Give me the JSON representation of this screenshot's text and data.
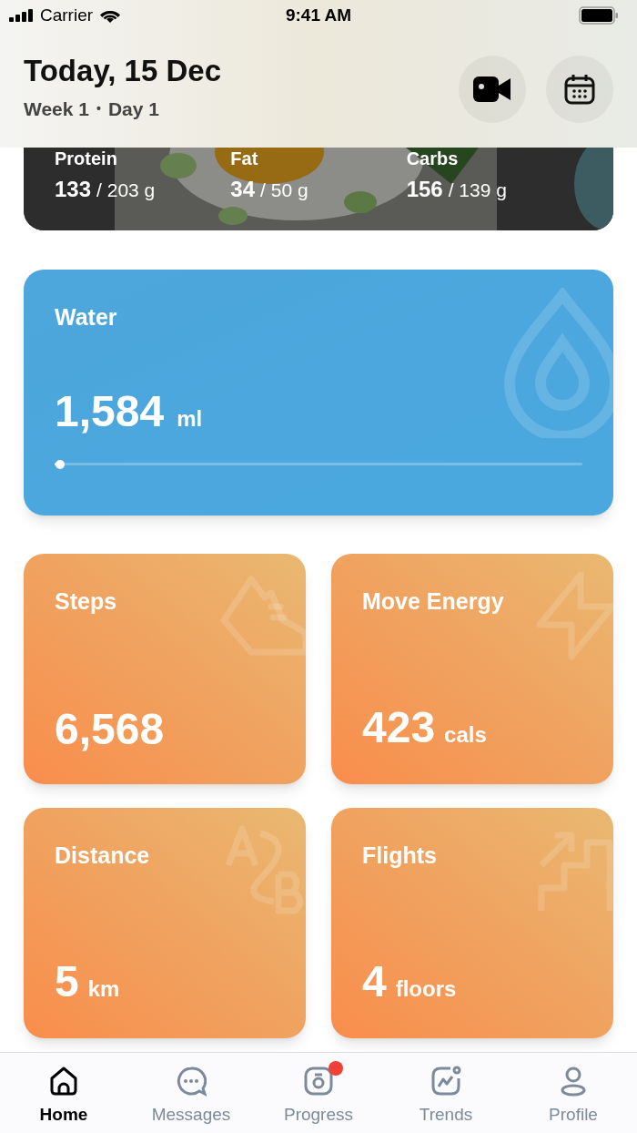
{
  "status_bar": {
    "carrier": "Carrier",
    "time": "9:41 AM"
  },
  "header": {
    "title": "Today, 15 Dec",
    "week": "Week 1",
    "separator": "•",
    "day": "Day 1"
  },
  "macros": [
    {
      "label": "Protein",
      "value": "133",
      "goal": "/ 203 g"
    },
    {
      "label": "Fat",
      "value": "34",
      "goal": "/ 50 g"
    },
    {
      "label": "Carbs",
      "value": "156",
      "goal": "/ 139 g"
    }
  ],
  "water": {
    "label": "Water",
    "value": "1,584",
    "unit": "ml",
    "level": 0.01
  },
  "tiles": [
    {
      "kind": "steps",
      "label": "Steps",
      "value": "6,568"
    },
    {
      "kind": "energy",
      "label": "Move Energy",
      "value": "423",
      "unit": "cals"
    },
    {
      "kind": "distance",
      "label": "Distance",
      "value": "5",
      "unit": "km"
    },
    {
      "kind": "flights",
      "label": "Flights",
      "value": "4",
      "unit": "floors"
    }
  ],
  "tabs": [
    {
      "kind": "home",
      "label": "Home",
      "selected": true,
      "badge": false
    },
    {
      "kind": "messages",
      "label": "Messages",
      "selected": false,
      "badge": false
    },
    {
      "kind": "progress",
      "label": "Progress",
      "selected": false,
      "badge": true
    },
    {
      "kind": "trends",
      "label": "Trends",
      "selected": false,
      "badge": false
    },
    {
      "kind": "profile",
      "label": "Profile",
      "selected": false,
      "badge": false
    }
  ]
}
